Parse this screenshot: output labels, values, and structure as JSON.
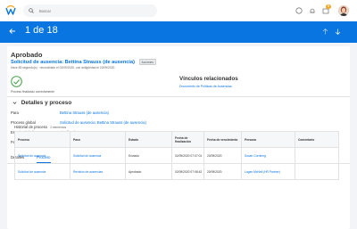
{
  "topbar": {
    "search_placeholder": "Buscar",
    "notification_count": "9"
  },
  "header": {
    "title": "1 de 18"
  },
  "record": {
    "status": "Aprobado",
    "subject": "Solicitud de ausencia: Bettina Strauss (de ausencia)",
    "subject_tag": "Acciones",
    "meta": "Hace 85 segundo(s) · reconciliado el 02/09/2020, con antigüedad el 20/09/2020",
    "check_label": "Proceso finalizado correctamente"
  },
  "related": {
    "title": "Vínculos relacionados",
    "link": "Documento de Políticas de Ausencias"
  },
  "details": {
    "section_title": "Detalles y proceso",
    "rows": [
      {
        "label": "Para",
        "value": "Bettina Strauss (de ausencia)"
      },
      {
        "label": "Proceso global",
        "value": "Solicitud de ausencia: Bettina Strauss (de ausencia)"
      },
      {
        "label": "Estado global",
        "value": "Finalizado correctamente"
      },
      {
        "label": "Fecha de vencimiento",
        "value": "20/09/2020"
      }
    ]
  },
  "tabs": [
    {
      "label": "Detalles"
    },
    {
      "label": "Proceso"
    }
  ],
  "history": {
    "title": "Historial de proceso",
    "count": "2 elementos"
  },
  "table": {
    "headers": [
      "Proceso",
      "Paso",
      "Estado",
      "Fecha de finalización",
      "Fecha de vencimiento",
      "Persona",
      "Comentario"
    ],
    "rows": [
      [
        "Solicitud de ausencia",
        "Solicitud de ausencia",
        "Enviado",
        "02/09/2020 07:07:01",
        "20/09/2020",
        "Susan Cornberg",
        ""
      ],
      [
        "Solicitud de ausencia",
        "Revisión de ausencias",
        "Aprobado",
        "02/09/2020 07:08:42",
        "20/09/2020",
        "Logan McNeil (HR Partner)",
        ""
      ]
    ]
  },
  "colors": {
    "accent": "#0875e1",
    "success": "#43a047",
    "notification": "#f5a623"
  }
}
